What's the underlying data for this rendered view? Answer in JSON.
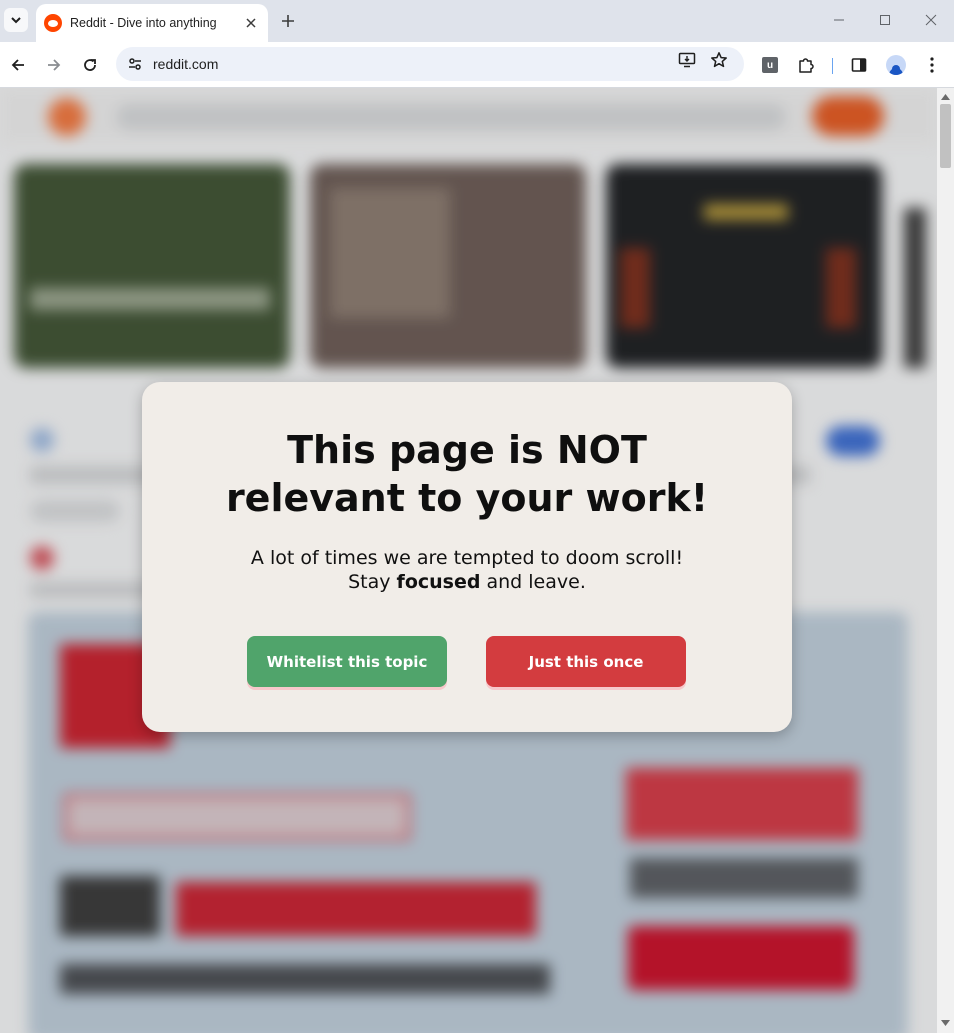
{
  "browser": {
    "tab": {
      "title": "Reddit - Dive into anything",
      "favicon": "reddit-icon"
    },
    "url": "reddit.com",
    "colors": {
      "reddit_orange": "#ff4500"
    }
  },
  "modal": {
    "title_part1": "This page is ",
    "title_emphasis": "NOT",
    "title_part2": "relevant to your work!",
    "message_line1": "A lot of times we are tempted to doom scroll!",
    "message_line2_before": "Stay ",
    "message_line2_emphasis": "focused",
    "message_line2_after": " and leave.",
    "primary_button": "Whitelist this topic",
    "secondary_button": "Just this once",
    "colors": {
      "background": "#f1ede8",
      "primary": "#50a46b",
      "secondary": "#d33c3f"
    }
  }
}
